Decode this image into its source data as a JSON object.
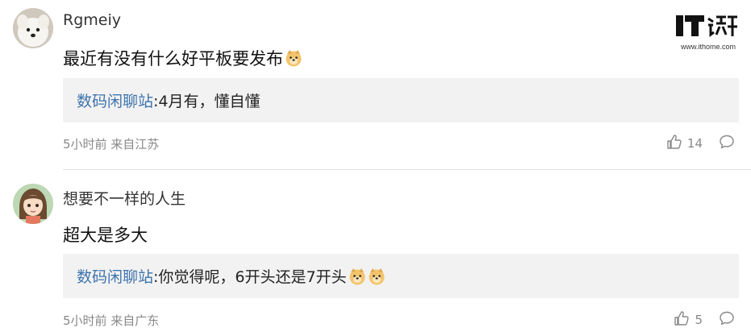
{
  "logo": {
    "url_text": "www.ithome.com"
  },
  "comments": [
    {
      "username": "Rgmeiy",
      "content": "最近有没有什么好平板要发布",
      "reply": {
        "name": "数码闲聊站",
        "text": ":4月有，懂自懂"
      },
      "meta": "5小时前 来自江苏",
      "likes": "14"
    },
    {
      "username": "想要不一样的人生",
      "content": "超大是多大",
      "reply": {
        "name": "数码闲聊站",
        "text": ":你觉得呢，6开头还是7开头"
      },
      "meta": "5小时前 来自广东",
      "likes": "5"
    }
  ]
}
